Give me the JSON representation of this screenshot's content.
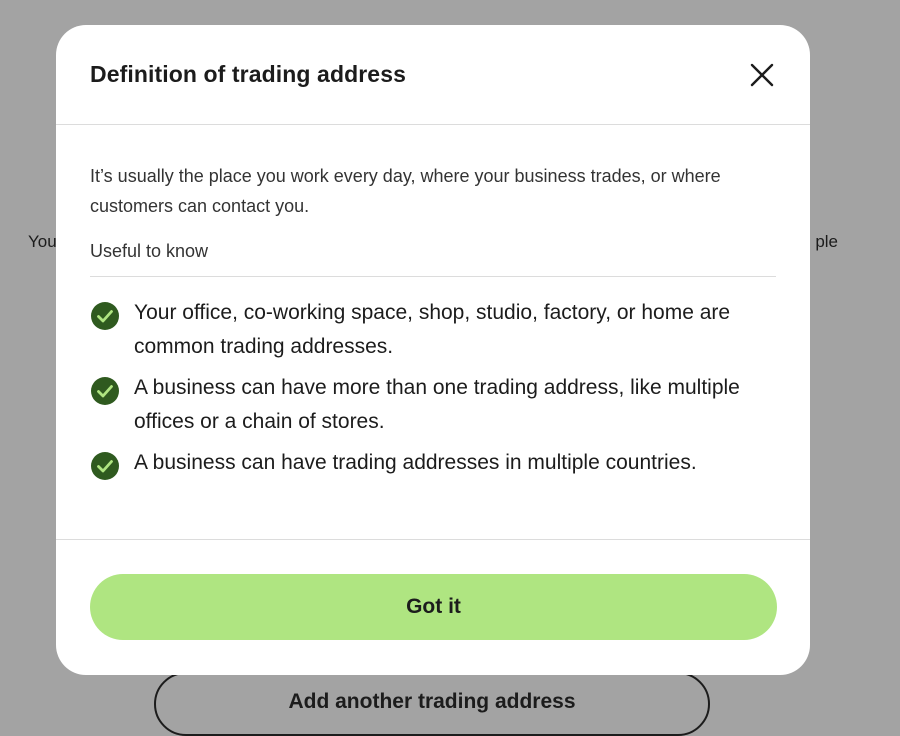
{
  "background": {
    "left_text": "You",
    "right_text": "ple",
    "add_button_label": "Add another trading address"
  },
  "modal": {
    "title": "Definition of trading address",
    "intro": "It’s usually the place you work every day, where your business trades, or where customers can contact you.",
    "subheading": "Useful to know",
    "items": [
      {
        "text": "Your office, co-working space, shop, studio, factory, or home are common trading addresses."
      },
      {
        "text": "A business can have more than one trading address, like multiple offices or a chain of stores."
      },
      {
        "text": "A business can have trading addresses in multiple countries."
      }
    ],
    "confirm_label": "Got it"
  },
  "colors": {
    "overlay": "#a3a3a3",
    "accent": "#afe581",
    "check": "#2f5a1f",
    "text": "#1c1c1c"
  }
}
